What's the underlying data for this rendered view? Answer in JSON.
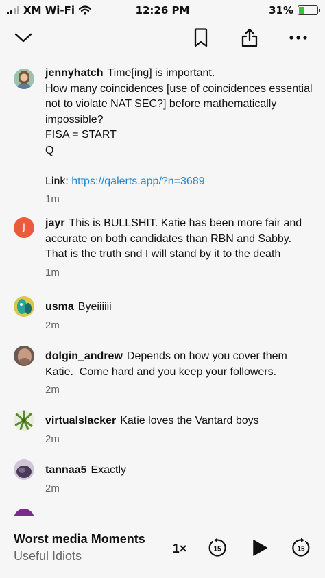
{
  "status_bar": {
    "carrier": "XM Wi-Fi",
    "time": "12:26 PM",
    "battery": "31%",
    "battery_level": 0.31,
    "icons": [
      "signal-icon",
      "wifi-icon",
      "battery-icon"
    ]
  },
  "nav": {
    "icons": [
      "chevron-down-icon",
      "bookmark-icon",
      "share-icon",
      "more-icon"
    ]
  },
  "comments": [
    {
      "user": "jennyhatch",
      "text": "Time[ing] is important.\nHow many coincidences [use of coincidences essential not to violate NAT SEC?] before mathematically impossible?\nFISA = START\nQ\n\nLink: ",
      "link": "https://qalerts.app/?n=3689",
      "time": "1m",
      "avatar_color": "#8fb6a0"
    },
    {
      "user": "jayr",
      "text": "This is BULLSHIT. Katie has been more fair and accurate on both candidates than RBN and Sabby. That is the truth snd I will stand by it to the death",
      "time": "1m",
      "avatar_letter": "J",
      "avatar_color": "#ec5a3c"
    },
    {
      "user": "usma",
      "text": "Byeiiiiii",
      "time": "2m",
      "avatar_color": "#3aa59a"
    },
    {
      "user": "dolgin_andrew",
      "text": "Depends on how you cover them Katie.  Come hard and you keep your followers.",
      "time": "2m",
      "avatar_color": "#9a7a68"
    },
    {
      "user": "virtualslacker",
      "text": "Katie loves the Vantard boys",
      "time": "2m",
      "avatar_color": "#7aa84a"
    },
    {
      "user": "tannaa5",
      "text": "Exactly",
      "time": "2m",
      "avatar_color": "#5a4a6a"
    }
  ],
  "player": {
    "title": "Worst media Moments",
    "subtitle": "Useful Idiots",
    "speed": "1×",
    "skip_back": "15",
    "skip_forward": "15"
  }
}
